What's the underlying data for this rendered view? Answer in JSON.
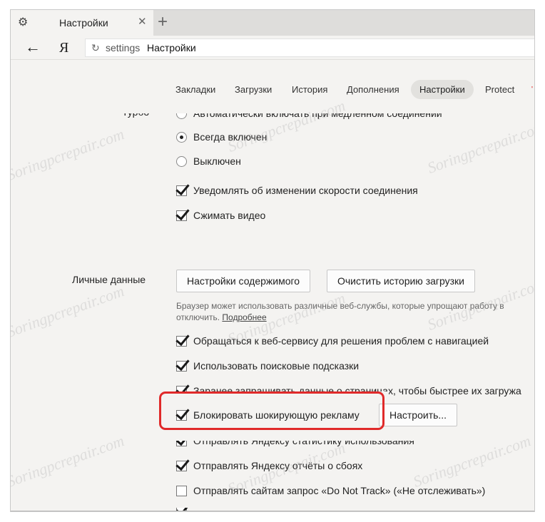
{
  "tab": {
    "title": "Настройки",
    "icon": "gear-icon"
  },
  "address": {
    "scheme": "settings",
    "title": "Настройки",
    "logo": "Я"
  },
  "nav": {
    "items": [
      "Закладки",
      "Загрузки",
      "История",
      "Дополнения",
      "Настройки",
      "Protect"
    ],
    "active": "Настройки"
  },
  "traffic": {
    "cut_label": "Турбо",
    "options": [
      {
        "label": "Автоматически включать при медленном соединении",
        "checked": false
      },
      {
        "label": "Всегда включен",
        "checked": true
      },
      {
        "label": "Выключен",
        "checked": false
      }
    ],
    "checkboxes": [
      {
        "label": "Уведомлять об изменении скорости соединения",
        "checked": true
      },
      {
        "label": "Сжимать видео",
        "checked": true
      }
    ]
  },
  "privacy": {
    "section_label": "Личные данные",
    "content_settings_button": "Настройки содержимого",
    "clear_history_button": "Очистить историю загрузки",
    "description": "Браузер может использовать различные веб-службы, которые упрощают работу в",
    "description_line2": "отключить.",
    "more_link": "Подробнее",
    "checkboxes": [
      {
        "label": "Обращаться к веб-сервису для решения проблем с навигацией",
        "checked": true
      },
      {
        "label": "Использовать поисковые подсказки",
        "checked": true
      },
      {
        "label": "Заранее запрашивать данные о страницах, чтобы быстрее их загружа",
        "checked": true
      },
      {
        "label": "Блокировать шокирующую рекламу",
        "checked": true
      },
      {
        "label": "Отправлять Яндексу статистику использования",
        "checked": true
      },
      {
        "label": "Отправлять Яндексу отчёты о сбоях",
        "checked": true
      },
      {
        "label": "Отправлять сайтам запрос «Do Not Track» («Не отслеживать»)",
        "checked": false
      }
    ],
    "configure_button": "Настроить..."
  },
  "watermark": "Soringpcrepair.com",
  "colors": {
    "highlight": "#e02a2a",
    "active_tab_bg": "#e2e1de",
    "window_bg": "#f4f3f1"
  }
}
